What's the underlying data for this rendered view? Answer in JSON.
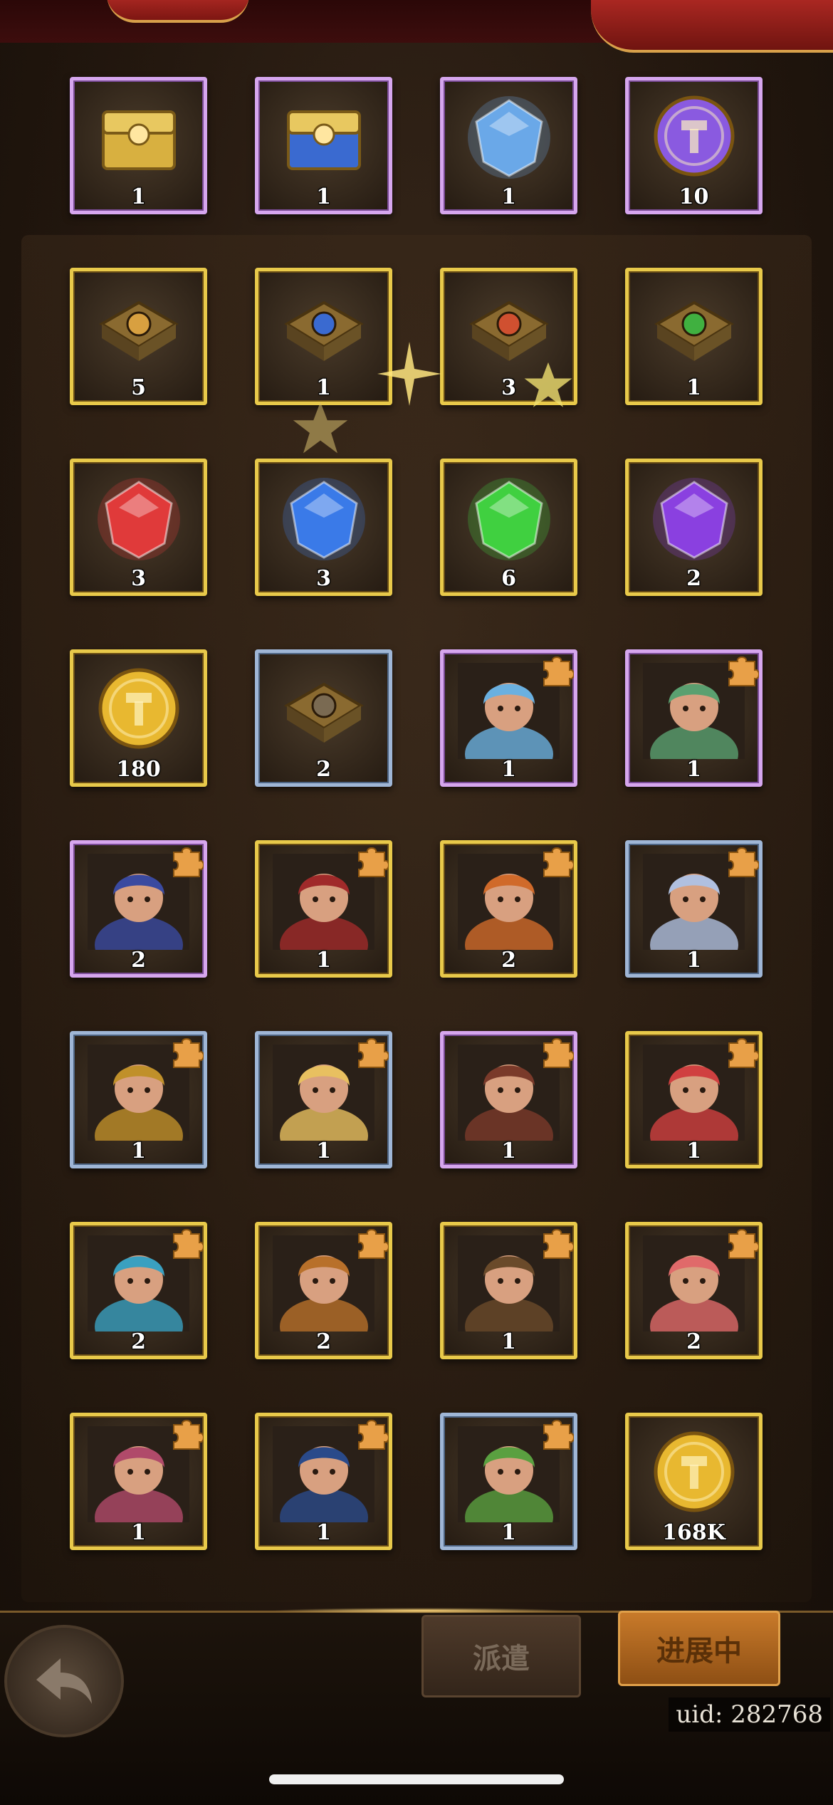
{
  "rewards": [
    {
      "kind": "chest",
      "color": "#d8b040",
      "count": "1",
      "frame": "purple",
      "fragment": false
    },
    {
      "kind": "chest",
      "color": "#3a6ad0",
      "count": "1",
      "frame": "purple",
      "fragment": false
    },
    {
      "kind": "crystal",
      "color": "#6aa8e8",
      "count": "1",
      "frame": "purple",
      "fragment": false
    },
    {
      "kind": "coin",
      "color": "#8a5ae0",
      "count": "10",
      "frame": "purple",
      "fragment": false
    },
    {
      "kind": "book",
      "color": "#d8a040",
      "count": "5",
      "frame": "gold",
      "fragment": false
    },
    {
      "kind": "book",
      "color": "#3a6ad0",
      "count": "1",
      "frame": "gold",
      "fragment": false
    },
    {
      "kind": "book",
      "color": "#d05030",
      "count": "3",
      "frame": "gold",
      "fragment": false
    },
    {
      "kind": "book",
      "color": "#40b040",
      "count": "1",
      "frame": "gold",
      "fragment": false
    },
    {
      "kind": "crystal",
      "color": "#e03a3a",
      "count": "3",
      "frame": "gold",
      "fragment": false
    },
    {
      "kind": "crystal",
      "color": "#3a7ae8",
      "count": "3",
      "frame": "gold",
      "fragment": false
    },
    {
      "kind": "crystal",
      "color": "#40d040",
      "count": "6",
      "frame": "gold",
      "fragment": false
    },
    {
      "kind": "crystal",
      "color": "#8a40e0",
      "count": "2",
      "frame": "gold",
      "fragment": false
    },
    {
      "kind": "coin",
      "color": "#e8b830",
      "count": "180",
      "frame": "gold",
      "fragment": false
    },
    {
      "kind": "book",
      "color": "#7a6a52",
      "count": "2",
      "frame": "blue",
      "fragment": false
    },
    {
      "kind": "hero",
      "color": "#6ab0e0",
      "count": "1",
      "frame": "purple",
      "fragment": true
    },
    {
      "kind": "hero",
      "color": "#5aa070",
      "count": "1",
      "frame": "purple",
      "fragment": true
    },
    {
      "kind": "hero",
      "color": "#3a4aa0",
      "count": "2",
      "frame": "purple",
      "fragment": true
    },
    {
      "kind": "hero",
      "color": "#a02a2a",
      "count": "1",
      "frame": "gold",
      "fragment": true
    },
    {
      "kind": "hero",
      "color": "#d06a2a",
      "count": "2",
      "frame": "gold",
      "fragment": true
    },
    {
      "kind": "hero",
      "color": "#b0c0e0",
      "count": "1",
      "frame": "blue",
      "fragment": true
    },
    {
      "kind": "hero",
      "color": "#c0902a",
      "count": "1",
      "frame": "blue",
      "fragment": true
    },
    {
      "kind": "hero",
      "color": "#e8c060",
      "count": "1",
      "frame": "blue",
      "fragment": true
    },
    {
      "kind": "hero",
      "color": "#7a3a2a",
      "count": "1",
      "frame": "purple",
      "fragment": true
    },
    {
      "kind": "hero",
      "color": "#d04040",
      "count": "1",
      "frame": "gold",
      "fragment": true
    },
    {
      "kind": "hero",
      "color": "#3aa0c0",
      "count": "2",
      "frame": "gold",
      "fragment": true
    },
    {
      "kind": "hero",
      "color": "#b8702a",
      "count": "2",
      "frame": "gold",
      "fragment": true
    },
    {
      "kind": "hero",
      "color": "#6a4a2a",
      "count": "1",
      "frame": "gold",
      "fragment": true
    },
    {
      "kind": "hero",
      "color": "#e06a6a",
      "count": "2",
      "frame": "gold",
      "fragment": true
    },
    {
      "kind": "hero",
      "color": "#b04a6a",
      "count": "1",
      "frame": "gold",
      "fragment": true
    },
    {
      "kind": "hero",
      "color": "#2a4a8a",
      "count": "1",
      "frame": "gold",
      "fragment": true
    },
    {
      "kind": "hero",
      "color": "#5aa040",
      "count": "1",
      "frame": "blue",
      "fragment": true
    },
    {
      "kind": "coin",
      "color": "#e8b830",
      "count": "168K",
      "frame": "gold",
      "fragment": false
    }
  ],
  "buttons": {
    "dispatch": "派遣",
    "in_progress": "进展中"
  },
  "uid": "uid: 282768",
  "icons": {
    "back": "back-arrow-icon",
    "fragment": "puzzle-piece-icon"
  }
}
